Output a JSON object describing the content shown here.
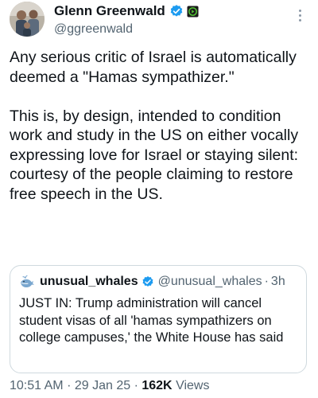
{
  "author": {
    "name": "Glenn Greenwald",
    "handle": "@ggreenwald",
    "verified_color": "#1d9bf0",
    "affiliate_icon": "play-badge-icon"
  },
  "tweet": {
    "text": "Any serious critic of Israel is automatically deemed a \"Hamas sympathizer.\"\n\nThis is, by design, intended to condition work and study in the US on either vocally expressing love for Israel or staying silent: courtesy of the people claiming to restore free speech in the US.",
    "time": "10:51 AM",
    "date": "29 Jan 25",
    "views_count": "162K",
    "views_label": "Views",
    "separator": "·"
  },
  "quote": {
    "avatar_icon": "whale-icon",
    "name": "unusual_whales",
    "handle": "@unusual_whales",
    "separator": "·",
    "time": "3h",
    "text": "JUST IN: Trump administration will cancel student visas of all 'hamas sympathizers on college campuses,' the White House has said"
  },
  "colors": {
    "accent": "#1d9bf0",
    "text_primary": "#0f1419",
    "text_secondary": "#536471",
    "border": "#cfd9de"
  }
}
